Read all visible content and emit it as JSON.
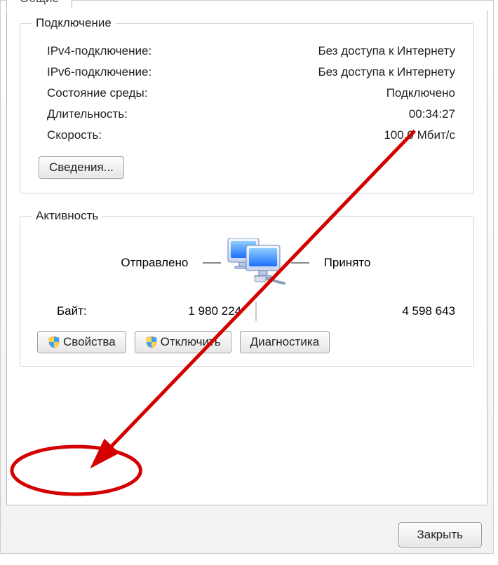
{
  "tabs": {
    "active": "Общие"
  },
  "connection": {
    "legend": "Подключение",
    "rows": {
      "ipv4": {
        "label": "IPv4-подключение:",
        "value": "Без доступа к Интернету"
      },
      "ipv6": {
        "label": "IPv6-подключение:",
        "value": "Без доступа к Интернету"
      },
      "media": {
        "label": "Состояние среды:",
        "value": "Подключено"
      },
      "duration": {
        "label": "Длительность:",
        "value": "00:34:27"
      },
      "speed": {
        "label": "Скорость:",
        "value": "100.0 Мбит/с"
      }
    },
    "details_btn": "Сведения..."
  },
  "activity": {
    "legend": "Активность",
    "sent_label": "Отправлено",
    "received_label": "Принято",
    "bytes_label": "Байт:",
    "bytes_sent": "1 980 224",
    "bytes_received": "4 598 643"
  },
  "actions": {
    "properties": "Свойства",
    "disable": "Отключить",
    "diagnose": "Диагностика",
    "close": "Закрыть"
  },
  "annotation": {
    "highlight": "properties-button"
  }
}
